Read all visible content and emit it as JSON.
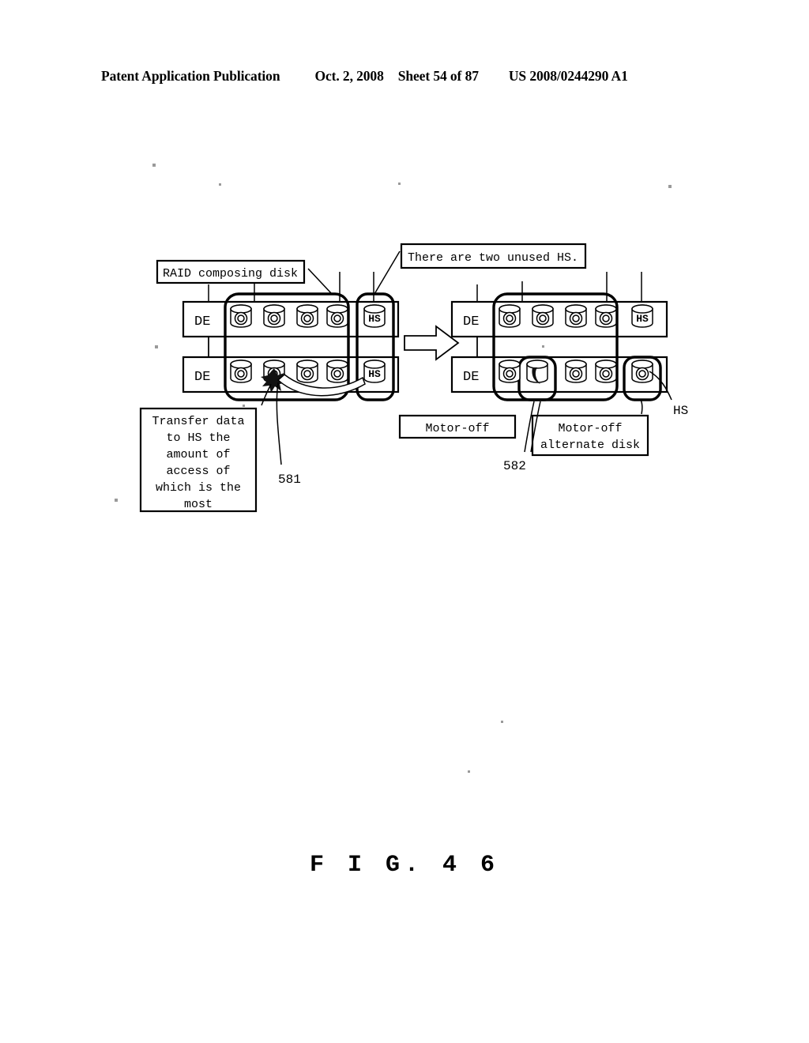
{
  "header": {
    "publication": "Patent Application Publication",
    "date": "Oct. 2, 2008",
    "sheet": "Sheet 54 of 87",
    "patent_number": "US 2008/0244290 A1"
  },
  "figure": {
    "caption": "F I G.  4 6",
    "labels": {
      "raid_composing_disk": "RAID composing disk",
      "two_unused_hs": "There are two unused HS.",
      "transfer_note": "Transfer data to HS the amount of access of which is the most",
      "transfer_note_lines": [
        "Transfer data",
        "to HS the",
        "amount of",
        "access of",
        "which is the",
        "most"
      ],
      "motor_off": "Motor-off",
      "motor_off_alternate_disk": "Motor-off alternate disk",
      "motor_off_alternate_disk_lines": [
        "Motor-off",
        "alternate disk"
      ],
      "hs_callout": "HS"
    },
    "reference_numerals": {
      "transfer_source": "581",
      "motor_off_disk": "582"
    },
    "enclosure_label": "DE",
    "hotspare_label": "HS",
    "left_diagram": {
      "title": "before",
      "rows": [
        {
          "enclosure": "DE",
          "disks": [
            {
              "type": "spindle",
              "state": "active"
            },
            {
              "type": "spindle",
              "state": "active"
            },
            {
              "type": "spindle",
              "state": "active"
            },
            {
              "type": "spindle",
              "state": "active"
            }
          ],
          "hot_spare": {
            "label": "HS",
            "state": "unused"
          }
        },
        {
          "enclosure": "DE",
          "disks": [
            {
              "type": "spindle",
              "state": "active"
            },
            {
              "type": "spindle",
              "state": "active-source"
            },
            {
              "type": "spindle",
              "state": "active"
            },
            {
              "type": "spindle",
              "state": "active"
            }
          ],
          "hot_spare": {
            "label": "HS",
            "state": "unused"
          }
        }
      ]
    },
    "right_diagram": {
      "title": "after",
      "rows": [
        {
          "enclosure": "DE",
          "disks": [
            {
              "type": "spindle",
              "state": "active"
            },
            {
              "type": "spindle",
              "state": "active"
            },
            {
              "type": "spindle",
              "state": "active"
            },
            {
              "type": "spindle",
              "state": "active"
            }
          ],
          "hot_spare": {
            "label": "HS",
            "state": "unused"
          }
        },
        {
          "enclosure": "DE",
          "disks": [
            {
              "type": "spindle",
              "state": "active"
            },
            {
              "type": "crescent",
              "state": "motor-off"
            },
            {
              "type": "spindle",
              "state": "active"
            },
            {
              "type": "spindle",
              "state": "active"
            }
          ],
          "hot_spare": {
            "label": "",
            "state": "in-use"
          }
        }
      ]
    },
    "transition_arrow": "right-arrow"
  }
}
